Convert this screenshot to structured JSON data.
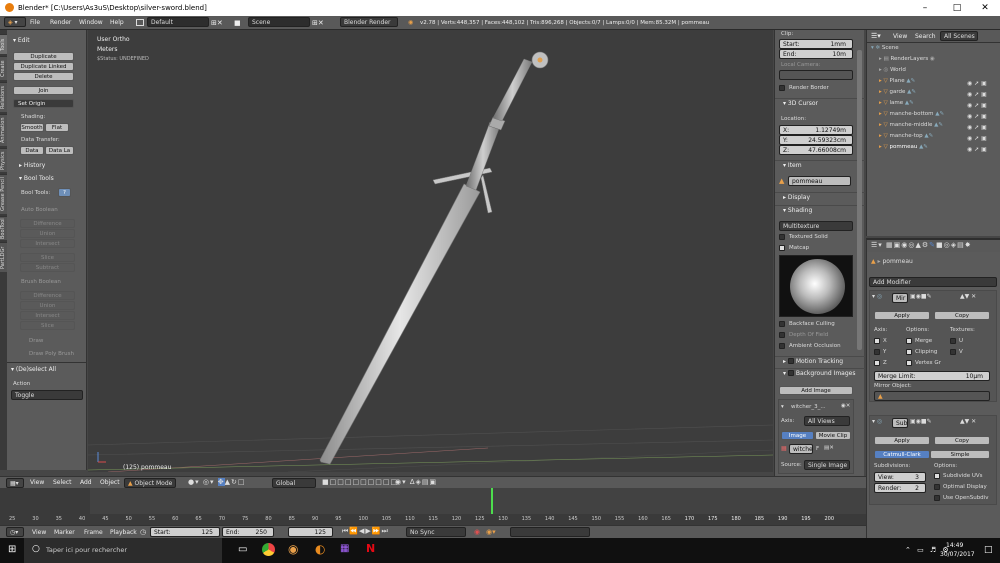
{
  "title": "Blender* [C:\\Users\\As3uS\\Desktop\\silver-sword.blend]",
  "menu": {
    "file": "File",
    "render": "Render",
    "window": "Window",
    "help": "Help",
    "layout": "Default",
    "scene": "Scene",
    "engine": "Blender Render",
    "stats": "v2.78 | Verts:448,357 | Faces:448,102 | Tris:896,268 | Objects:0/7 | Lamps:0/0 | Mem:85.32M | pommeau"
  },
  "toolshelf": {
    "tabs": [
      "Tools",
      "Create",
      "Relations",
      "Animation",
      "Physics",
      "Grease Pencil",
      "BoolTool",
      "PartLDGr"
    ],
    "edit_header": "Edit",
    "duplicate": "Duplicate",
    "duplicate_linked": "Duplicate Linked",
    "delete": "Delete",
    "join": "Join",
    "set_origin": "Set Origin",
    "shading_label": "Shading:",
    "smooth": "Smooth",
    "flat": "Flat",
    "data_transfer_label": "Data Transfer:",
    "data": "Data",
    "data_la": "Data La",
    "history": "History",
    "bool_tools": "Bool Tools",
    "bool_tools_label": "Bool Tools:",
    "auto_boolean": "Auto Boolean",
    "difference": "Difference",
    "union": "Union",
    "intersect": "Intersect",
    "slice": "Slice",
    "subtract": "Subtract",
    "brush_boolean": "Brush Boolean",
    "difference2": "Difference",
    "union2": "Union",
    "intersect2": "Intersect",
    "slice2": "Slice",
    "draw": "Draw",
    "draw_poly_brush": "Draw Poly Brush",
    "deselect_all": "(De)select All",
    "action_label": "Action",
    "action_value": "Toggle"
  },
  "viewport": {
    "view_name": "User Ortho",
    "units": "Meters",
    "status": "$Status: UNDEFINED",
    "selected": "(125) pommeau"
  },
  "npanel": {
    "clip": "Clip:",
    "start_label": "Start:",
    "start_value": "1mm",
    "end_label": "End:",
    "end_value": "10m",
    "local_camera": "Local Camera:",
    "render_border": "Render Border",
    "cursor": "3D Cursor",
    "location": "Location:",
    "x_label": "X:",
    "x_value": "1.12749m",
    "y_label": "Y:",
    "y_value": "24.59323cm",
    "z_label": "Z:",
    "z_value": "47.66008cm",
    "item": "Item",
    "item_name": "pommeau",
    "display": "Display",
    "shading": "Shading",
    "shading_mode": "Multitexture",
    "textured_solid": "Textured Solid",
    "matcap": "Matcap",
    "backface": "Backface Culling",
    "depth_of_field": "Depth Of Field",
    "ambient_occlusion": "Ambient Occlusion",
    "motion_tracking": "Motion Tracking",
    "background_images": "Background Images",
    "add_image": "Add Image",
    "bg_name": "witcher_3_...",
    "axis_label": "Axis:",
    "axis_value": "All Views",
    "image_tab": "Image",
    "movieclip_tab": "Movie Clip",
    "image_file": "witche",
    "f_label": "F",
    "source_label": "Source:",
    "source_value": "Single Image"
  },
  "outliner": {
    "view": "View",
    "search": "Search",
    "all_scenes": "All Scenes",
    "items": [
      "Scene",
      "RenderLayers",
      "World",
      "Plane",
      "garde",
      "lame",
      "manche-bottom",
      "manche-middle",
      "manche-top",
      "pommeau"
    ]
  },
  "props": {
    "object_name": "pommeau",
    "add_modifier": "Add Modifier",
    "mirror_name": "Mir",
    "apply": "Apply",
    "copy": "Copy",
    "axis": "Axis:",
    "options": "Options:",
    "textures": "Textures:",
    "x": "X",
    "y": "Y",
    "z": "Z",
    "merge": "Merge",
    "clipping": "Clipping",
    "vertex_gr": "Vertex Gr",
    "u": "U",
    "v": "V",
    "merge_limit": "Merge Limit:",
    "merge_limit_value": "10µm",
    "mirror_object": "Mirror Object:",
    "subsurf_name": "Sub",
    "apply2": "Apply",
    "copy2": "Copy",
    "catmull": "Catmull-Clark",
    "simple": "Simple",
    "subdivisions": "Subdivisions:",
    "options2": "Options:",
    "view_label": "View:",
    "view_value": "3",
    "render_label": "Render:",
    "render_value": "2",
    "subdivide_uvs": "Subdivide UVs",
    "optimal_display": "Optimal Display",
    "use_opensubdiv": "Use OpenSubdiv"
  },
  "vpheader": {
    "view": "View",
    "select": "Select",
    "add": "Add",
    "object": "Object",
    "mode": "Object Mode",
    "orientation": "Global"
  },
  "timeline": {
    "ticks": [
      "25",
      "30",
      "35",
      "40",
      "45",
      "50",
      "55",
      "60",
      "65",
      "70",
      "75",
      "80",
      "85",
      "90",
      "95",
      "100",
      "105",
      "110",
      "115",
      "120",
      "125",
      "130",
      "135",
      "140",
      "145",
      "150",
      "155",
      "160",
      "165",
      "170",
      "175",
      "180",
      "185",
      "190",
      "195",
      "200"
    ],
    "current_frame": 125
  },
  "tlheader": {
    "view": "View",
    "marker": "Marker",
    "frame": "Frame",
    "playback": "Playback",
    "start_label": "Start:",
    "start_value": "125",
    "end_label": "End:",
    "end_value": "250",
    "current": "125",
    "sync": "No Sync"
  },
  "taskbar": {
    "search": "Taper ici pour rechercher",
    "time": "14:49",
    "date": "30/07/2017"
  }
}
